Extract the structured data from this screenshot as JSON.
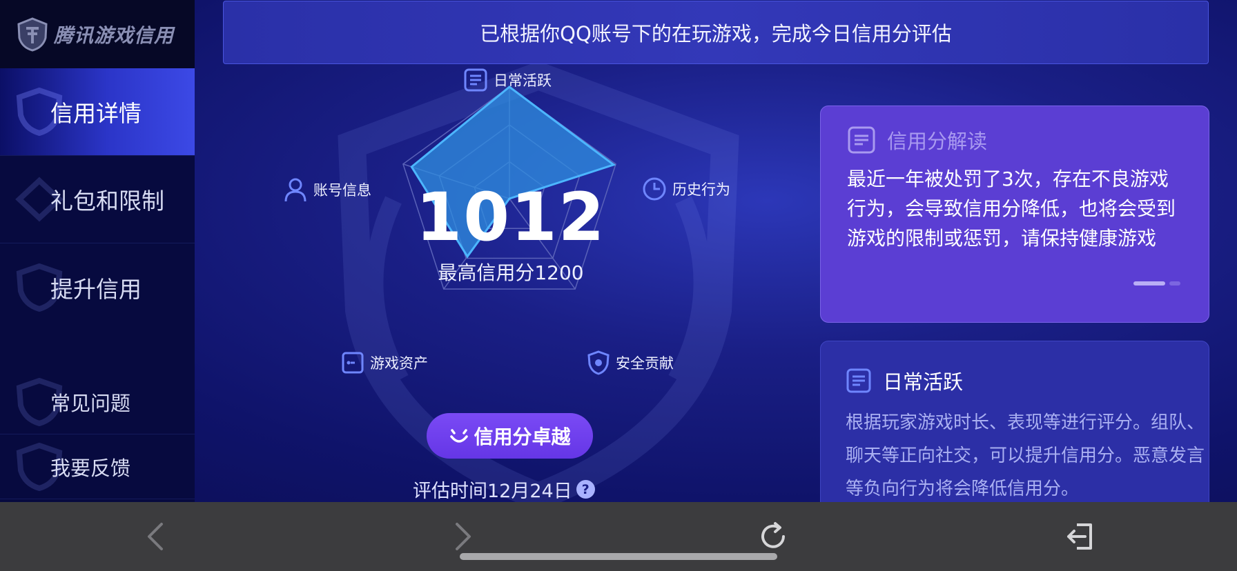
{
  "app": {
    "logo_text": "腾讯游戏信用"
  },
  "sidebar": {
    "items": [
      {
        "label": "信用详情",
        "active": true
      },
      {
        "label": "礼包和限制",
        "active": false
      },
      {
        "label": "提升信用",
        "active": false
      },
      {
        "label": "常见问题",
        "active": false
      },
      {
        "label": "我要反馈",
        "active": false
      }
    ]
  },
  "banner": {
    "text": "已根据你QQ账号下的在玩游戏，完成今日信用分评估"
  },
  "radar": {
    "axes": [
      {
        "label": "日常活跃",
        "icon": "document-icon"
      },
      {
        "label": "历史行为",
        "icon": "clock-icon"
      },
      {
        "label": "安全贡献",
        "icon": "shield-icon"
      },
      {
        "label": "游戏资产",
        "icon": "wallet-icon"
      },
      {
        "label": "账号信息",
        "icon": "user-icon"
      }
    ],
    "levels": [
      1.0,
      0.98,
      0.0,
      0.64,
      0.92
    ],
    "score": "1012",
    "score_sub": "最高信用分1200"
  },
  "grade_button": {
    "label": "信用分卓越",
    "icon": "smile-icon"
  },
  "eval_time": {
    "text": "评估时间12月24日",
    "help_icon": "?"
  },
  "card_interpret": {
    "title": "信用分解读",
    "body": "最近一年被处罚了3次，存在不良游戏行为，会导致信用分降低，也将会受到游戏的限制或惩罚，请保持健康游戏"
  },
  "card_daily": {
    "title": "日常活跃",
    "body": "根据玩家游戏时长、表现等进行评分。组队、聊天等正向社交，可以提升信用分。恶意发言等负向行为将会降低信用分。"
  },
  "browser": {
    "back_icon": "chevron-left-icon",
    "forward_icon": "chevron-right-icon",
    "refresh_icon": "refresh-icon",
    "exit_icon": "exit-icon"
  },
  "colors": {
    "sidebar_bg": "#070a3f",
    "active_item": "#3c49e6",
    "radar_fill": "#2f8fe0",
    "radar_stroke": "#4cb6ff",
    "grade_button": "#6f40ee",
    "card_interpret": "#5b3ed3",
    "card_daily": "#2c2fa6"
  }
}
